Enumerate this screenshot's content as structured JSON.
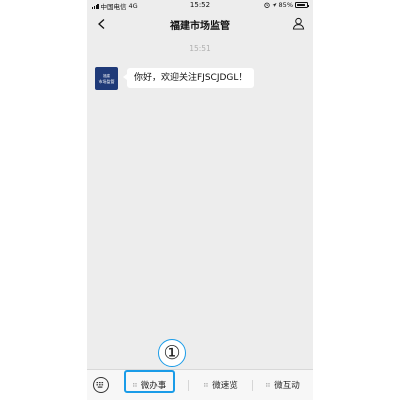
{
  "status_bar": {
    "carrier": "中国电信",
    "network": "4G",
    "time": "15:52",
    "battery": "85%"
  },
  "nav": {
    "title": "福建市场监管",
    "back_icon": "chevron-left-icon",
    "profile_icon": "user-icon"
  },
  "chat": {
    "timestamp": "15:51",
    "avatar_line1": "福建",
    "avatar_line2": "市场监管",
    "message": "你好，欢迎关注FJSCJDGL！"
  },
  "menu": {
    "keyboard_icon": "keyboard-icon",
    "items": [
      {
        "label": "微办事"
      },
      {
        "label": "微速览"
      },
      {
        "label": "微互动"
      }
    ]
  },
  "annotation": {
    "callout_number": "①",
    "highlight_color": "#1a9ce8"
  },
  "colors": {
    "background": "#ededed",
    "avatar": "#1f3a78"
  }
}
